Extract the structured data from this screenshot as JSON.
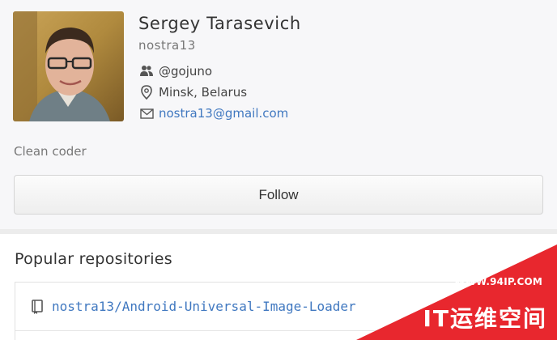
{
  "profile": {
    "full_name": "Sergey Tarasevich",
    "username": "nostra13",
    "organization": "@gojuno",
    "location": "Minsk, Belarus",
    "email": "nostra13@gmail.com",
    "bio": "Clean coder",
    "follow_label": "Follow",
    "icons": {
      "organization": "people-icon",
      "location": "map-pin-icon",
      "email": "envelope-icon"
    }
  },
  "repositories": {
    "title": "Popular repositories",
    "items": [
      {
        "label": "nostra13/Android-Universal-Image-Loader",
        "icon": "repo-book-icon"
      }
    ]
  },
  "watermark": {
    "url": "WWW.94IP.COM",
    "text": "IT运维空间",
    "color": "#e8272e"
  },
  "colors": {
    "link": "#4078c0",
    "background": "#f7f7f9",
    "watermark_red": "#e8272e"
  }
}
